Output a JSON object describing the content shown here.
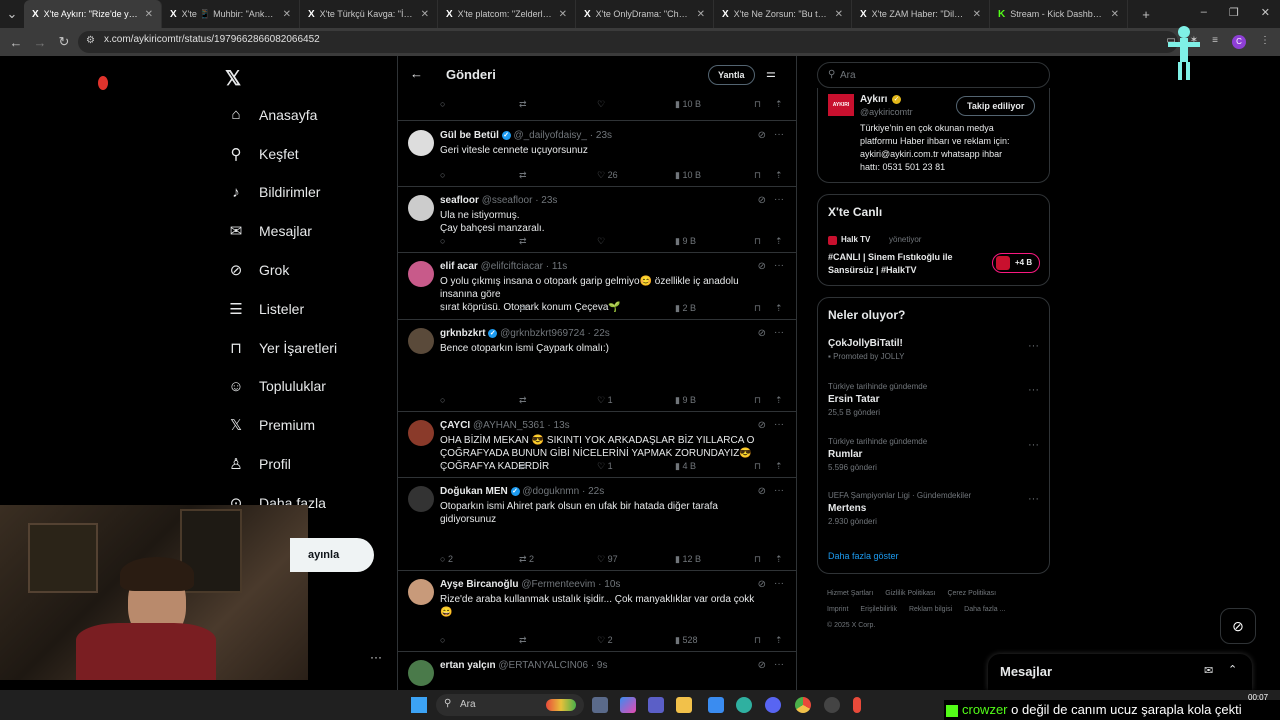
{
  "browser": {
    "tabs": [
      {
        "icon": "X",
        "title": "X'te Aykırı: \"Rize'de yapıla",
        "active": true
      },
      {
        "icon": "X",
        "title": "X'te 📱 Muhbir: \"Ankara'",
        "active": false
      },
      {
        "icon": "X",
        "title": "X'te Türkçü Kavga: \"İzmir",
        "active": false
      },
      {
        "icon": "X",
        "title": "X'te platcom: \"Zelderler, i",
        "active": false
      },
      {
        "icon": "X",
        "title": "X'te OnlyDrama: \"CharmC",
        "active": false
      },
      {
        "icon": "X",
        "title": "X'te Ne Zorsun: \"Bu tarika",
        "active": false
      },
      {
        "icon": "X",
        "title": "X'te ZAM Haber: \"Dilan P",
        "active": false
      },
      {
        "icon": "K",
        "title": "Stream - Kick Dashboard",
        "active": false
      }
    ],
    "url": "x.com/aykiricomtr/status/1979662866082066452"
  },
  "nav": {
    "items": [
      {
        "label": "Anasayfa",
        "icon": "home-icon"
      },
      {
        "label": "Keşfet",
        "icon": "search-icon"
      },
      {
        "label": "Bildirimler",
        "icon": "bell-icon"
      },
      {
        "label": "Mesajlar",
        "icon": "mail-icon"
      },
      {
        "label": "Grok",
        "icon": "grok-icon"
      },
      {
        "label": "Listeler",
        "icon": "list-icon"
      },
      {
        "label": "Yer İşaretleri",
        "icon": "bookmark-icon"
      },
      {
        "label": "Topluluklar",
        "icon": "people-icon"
      },
      {
        "label": "Premium",
        "icon": "x-icon"
      },
      {
        "label": "Profil",
        "icon": "person-icon"
      },
      {
        "label": "Daha fazla",
        "icon": "more-circle-icon"
      }
    ],
    "post_button": "ayınla"
  },
  "main": {
    "title": "Gönderi",
    "reply_filter": "Yantla",
    "top_actions": {
      "views": "10 B"
    },
    "tweets": [
      {
        "name": "Gül be Betül",
        "verified": true,
        "handle": "@_dailyofdaisy_ · 23s",
        "text": [
          "Geri vitesle cennete uçuyorsunuz"
        ],
        "replies": "",
        "reposts": "",
        "likes": "26",
        "views": "10 B"
      },
      {
        "name": "seafloor",
        "verified": false,
        "handle": "@sseafloor · 23s",
        "text": [
          "Ula ne istiyormuş.",
          "Çay bahçesi manzaralı."
        ],
        "replies": "",
        "reposts": "",
        "likes": "",
        "views": "9 B"
      },
      {
        "name": "elif acar",
        "verified": false,
        "handle": "@elifciftciacar · 11s",
        "text": [
          "O yolu çıkmış insana o otopark garip gelmiyo😊 özellikle iç anadolu",
          "insanına göre",
          "sırat köprüsü. Otopark konum Çeçeva🌱"
        ],
        "replies": "",
        "reposts": "",
        "likes": "",
        "views": "2 B"
      },
      {
        "name": "grknbzkrt",
        "verified": true,
        "handle": "@grknbzkrt969724 · 22s",
        "text": [
          "Bence otoparkın ismi Çaypark olmalı:)"
        ],
        "replies": "",
        "reposts": "",
        "likes": "1",
        "views": "9 B"
      },
      {
        "name": "ÇAYCI",
        "verified": false,
        "handle": "@AYHAN_5361 · 13s",
        "text": [
          "OHA BİZİM MEKAN 😎 SIKINTI YOK ARKADAŞLAR BİZ YILLARCA O",
          "ÇOĞRAFYADA BUNUN GİBİ NİCELERİNİ YAPMAK ZORUNDAYIZ😎",
          "ÇOĞRAFYA KADERDİR"
        ],
        "replies": "",
        "reposts": "",
        "likes": "1",
        "views": "4 B"
      },
      {
        "name": "Doğukan MEN",
        "verified": true,
        "handle": "@doguknmn · 22s",
        "text": [
          "Otoparkın ismi Ahiret park olsun en ufak bir hatada diğer tarafa",
          "gidiyorsunuz"
        ],
        "replies": "2",
        "reposts": "2",
        "likes": "97",
        "views": "12 B"
      },
      {
        "name": "Ayşe Bircanoğlu",
        "verified": false,
        "handle": "@Fermenteevim · 10s",
        "text": [
          "Rize'de araba kullanmak ustalık işidir... Çok manyaklıklar var orda çokk😄"
        ],
        "replies": "",
        "reposts": "",
        "likes": "2",
        "views": "528"
      },
      {
        "name": "ertan yalçın",
        "verified": false,
        "handle": "@ERTANYALCIN06 · 9s",
        "text": [],
        "replies": "",
        "reposts": "",
        "likes": "",
        "views": ""
      }
    ]
  },
  "right": {
    "search_placeholder": "Ara",
    "profile": {
      "name": "Aykırı",
      "handle": "@aykiricomtr",
      "follow_label": "Takip ediliyor",
      "logo_text": "AYKIRI",
      "bio": [
        "Türkiye'nin en çok okunan medya",
        "platformu Haber ihbarı ve reklam için:",
        "aykiri@aykiri.com.tr whatsapp ihbar",
        "hattı: 0531 501 23 81"
      ]
    },
    "live": {
      "title": "X'te Canlı",
      "host": "Halk TV",
      "host_role": "yönetiyor",
      "text": [
        "#CANLI | Sinem Fıstıkoğlu ile",
        "Sansürsüz | #HalkTV"
      ],
      "listeners": "+4 B"
    },
    "trends": {
      "title": "Neler oluyor?",
      "items": [
        {
          "context": "",
          "title": "ÇokJollyBiTatil!",
          "count": "Promoted by JOLLY"
        },
        {
          "context": "Türkiye tarihinde gündemde",
          "title": "Ersin Tatar",
          "count": "25,5 B gönderi"
        },
        {
          "context": "Türkiye tarihinde gündemde",
          "title": "Rumlar",
          "count": "5.596 gönderi"
        },
        {
          "context": "UEFA Şampiyonlar Ligi · Gündemdekiler",
          "title": "Mertens",
          "count": "2.930 gönderi"
        }
      ],
      "show_more": "Daha fazla göster"
    },
    "footer": [
      "Hizmet Şartları",
      "Gizlilik Politikası",
      "Çerez Politikası",
      "Imprint",
      "Erişilebilirlik",
      "Reklam bilgisi",
      "Daha fazla ...",
      "© 2025 X Corp."
    ]
  },
  "messages_drawer": {
    "title": "Mesajlar"
  },
  "taskbar": {
    "search_placeholder": "Ara",
    "clock": "00:07"
  },
  "stream_overlay": {
    "user": "crowzer",
    "message": "o değil de canım ucuz şarapla kola çekti"
  },
  "colors": {
    "accent": "#1d9bf0",
    "bg": "#000000",
    "border": "#2f3336",
    "muted": "#71767b",
    "kick": "#53fc18"
  }
}
